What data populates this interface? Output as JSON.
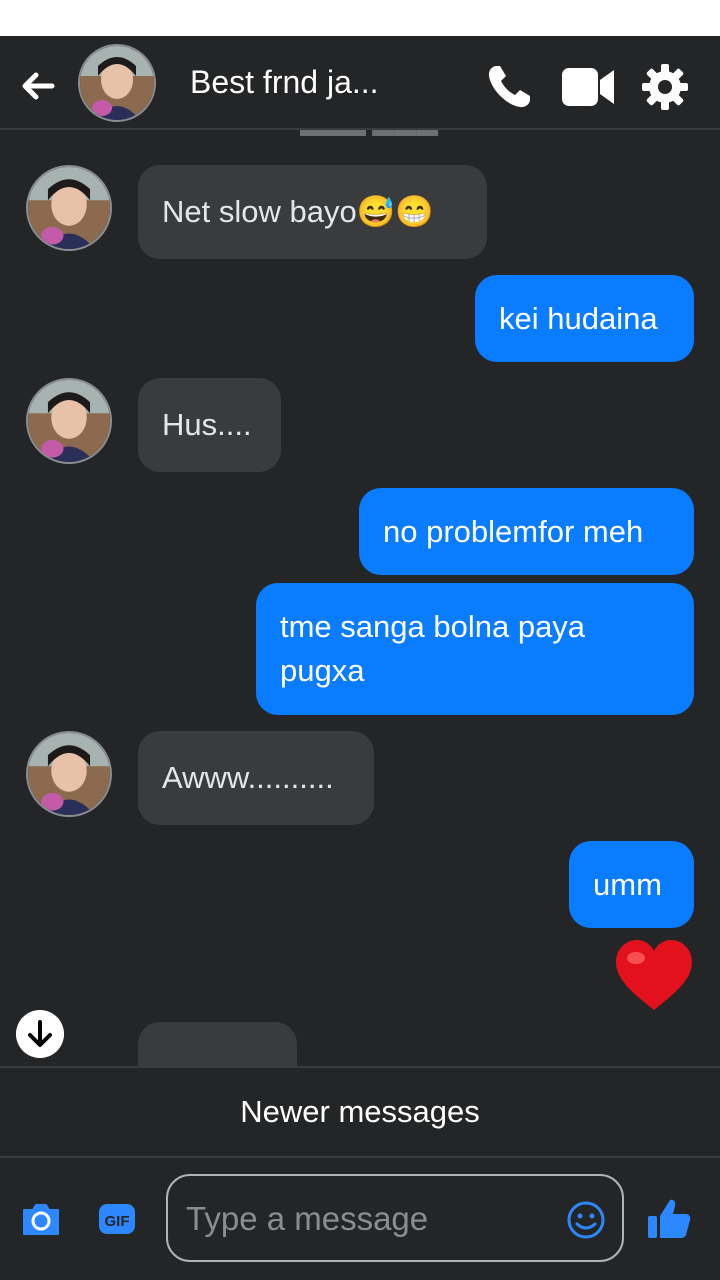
{
  "header": {
    "title": "Best frnd ja...",
    "back_icon": "arrow-left-icon",
    "actions": [
      "phone-icon",
      "video-camera-icon",
      "gear-icon"
    ]
  },
  "messages": [
    {
      "from": "them",
      "text": "Net slow bayo😅😁"
    },
    {
      "from": "me",
      "text": "kei hudaina"
    },
    {
      "from": "them",
      "text": "Hus...."
    },
    {
      "from": "me",
      "text": "no problemfor meh"
    },
    {
      "from": "me",
      "text": "tme sanga bolna paya pugxa"
    },
    {
      "from": "them",
      "text": "Awww.........."
    },
    {
      "from": "me",
      "text": "umm"
    },
    {
      "from": "me",
      "reaction": "heart"
    }
  ],
  "composer": {
    "placeholder": "Type a message",
    "newer_messages_label": "Newer messages",
    "icons": [
      "camera-icon",
      "gif-icon",
      "emoji-icon",
      "thumbs-up-icon"
    ]
  },
  "colors": {
    "background": "#242526",
    "incoming_bubble": "#3a3b3c",
    "outgoing_bubble": "#0a7cff",
    "accent": "#2d88ff"
  }
}
